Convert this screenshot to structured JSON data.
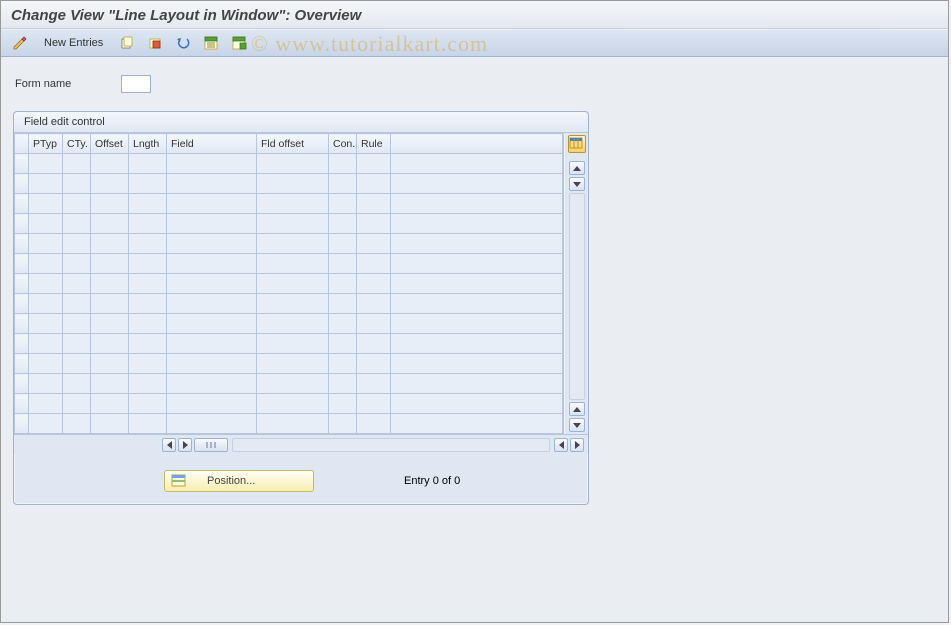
{
  "title": "Change View \"Line Layout in Window\": Overview",
  "watermark": "© www.tutorialkart.com",
  "toolbar": {
    "new_entries": "New Entries"
  },
  "form": {
    "name_label": "Form name",
    "name_value": ""
  },
  "panel": {
    "title": "Field edit control",
    "columns": {
      "ptyp": "PTyp",
      "cty": "CTy.",
      "offset": "Offset",
      "length": "Lngth",
      "field": "Field",
      "fld_offset": "Fld offset",
      "con": "Con.",
      "rule": "Rule"
    },
    "rows": 14,
    "position_label": "Position...",
    "entry_text": "Entry 0 of 0"
  }
}
